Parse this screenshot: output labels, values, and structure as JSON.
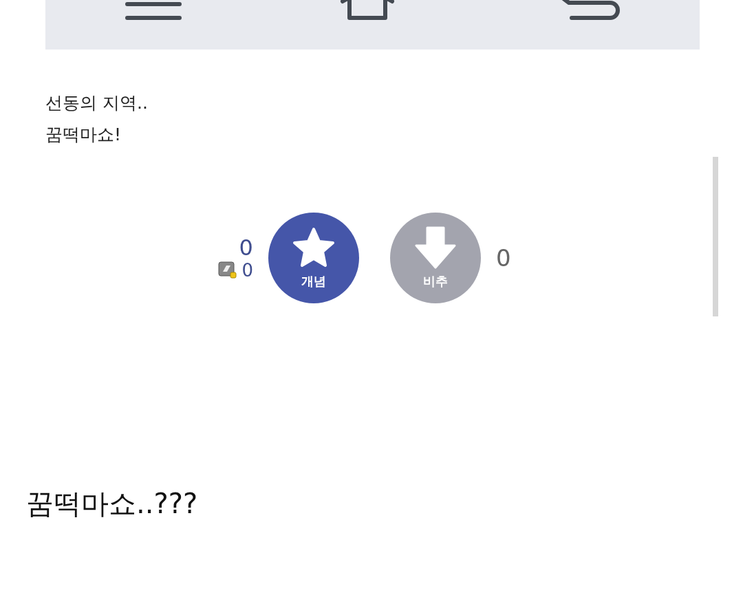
{
  "post": {
    "lines": [
      "선동의 지역..",
      "꿈떡마쇼!"
    ]
  },
  "votes": {
    "up_count": "0",
    "fixed_count": "0",
    "up_label": "개념",
    "down_label": "비추",
    "down_count": "0"
  },
  "caption": "꿈떡마쇼..???"
}
